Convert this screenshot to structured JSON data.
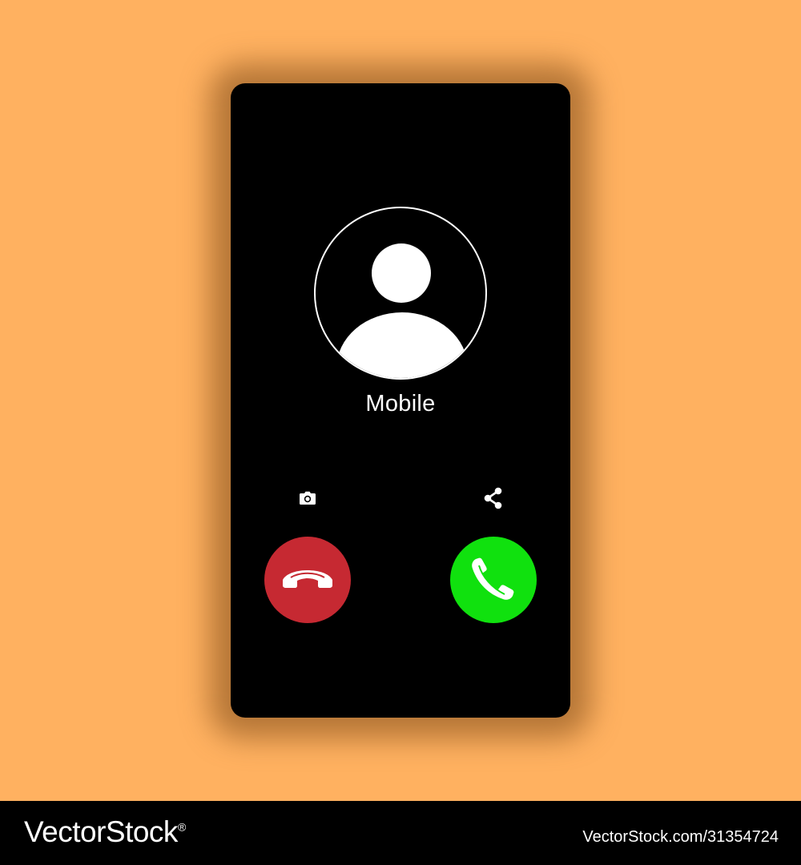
{
  "colors": {
    "background": "#FFB160",
    "phone_screen": "#000000",
    "decline_button": "#C62932",
    "accept_button": "#10E10E",
    "icon": "#FFFFFF"
  },
  "call_screen": {
    "caller_name": "Mobile",
    "avatar_icon": "person-silhouette-icon",
    "quick_actions": [
      {
        "name": "camera",
        "icon": "camera-icon"
      },
      {
        "name": "share",
        "icon": "share-icon"
      }
    ],
    "decline": {
      "icon": "phone-hangup-icon",
      "color": "#C62932"
    },
    "accept": {
      "icon": "phone-answer-icon",
      "color": "#10E10E"
    }
  },
  "watermark": {
    "brand": "VectorStock",
    "registered": "®",
    "url_id": "VectorStock.com/31354724"
  }
}
